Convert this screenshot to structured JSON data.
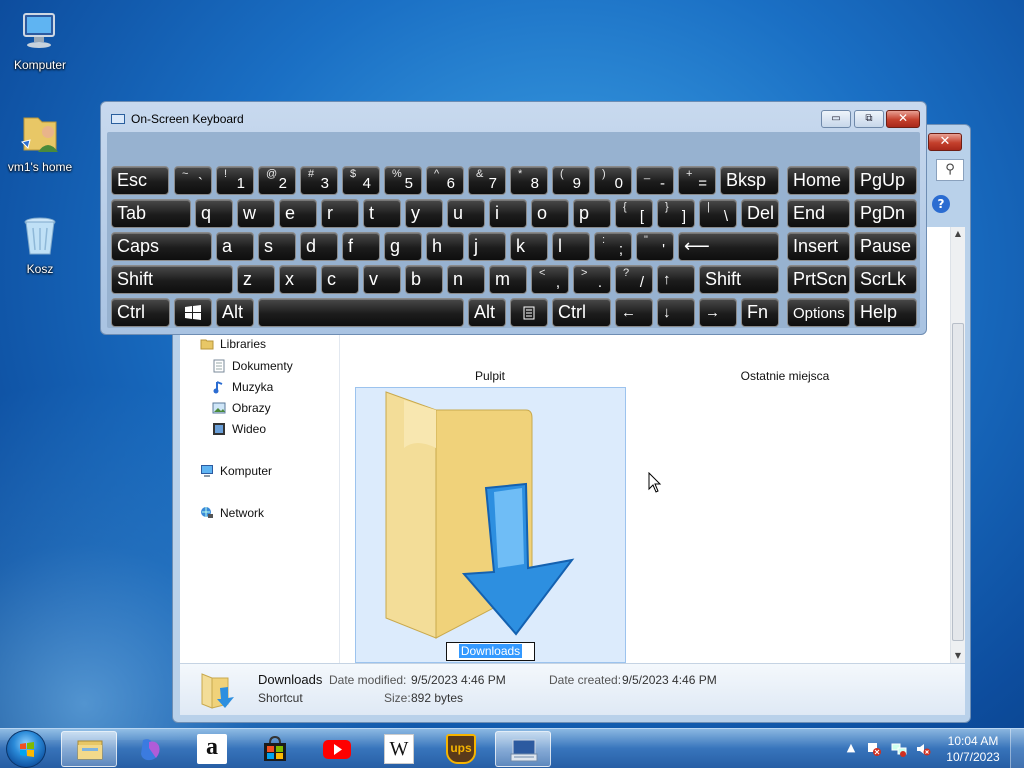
{
  "desktop": {
    "icons": [
      {
        "label": "Komputer"
      },
      {
        "label": "vm1's home"
      },
      {
        "label": "Kosz"
      }
    ]
  },
  "explorer": {
    "close_label": "✕",
    "search_icon": "search-icon",
    "help_label": "?",
    "nav": {
      "libraries": "Libraries",
      "dokumenty": "Dokumenty",
      "muzyka": "Muzyka",
      "obrazy": "Obrazy",
      "wideo": "Wideo",
      "komputer": "Komputer",
      "network": "Network"
    },
    "items": {
      "pulpit": "Pulpit",
      "ostatnie": "Ostatnie miejsca",
      "rename_value": "Downloads"
    },
    "details": {
      "name": "Downloads",
      "type": "Shortcut",
      "modified_label": "Date modified:",
      "modified_value": "9/5/2023 4:46 PM",
      "created_label": "Date created:",
      "created_value": "9/5/2023 4:46 PM",
      "size_label": "Size:",
      "size_value": "892 bytes"
    }
  },
  "osk": {
    "title": "On-Screen Keyboard",
    "window_buttons": {
      "minimize": "▭",
      "restore": "⧉",
      "close": "✕"
    },
    "keys": {
      "esc": "Esc",
      "tab": "Tab",
      "caps": "Caps",
      "shift_l": "Shift",
      "ctrl_l": "Ctrl",
      "alt_l": "Alt",
      "alt_r": "Alt",
      "ctrl_r": "Ctrl",
      "bksp": "Bksp",
      "del": "Del",
      "shift_r": "Shift",
      "home": "Home",
      "pgup": "PgUp",
      "end": "End",
      "pgdn": "PgDn",
      "insert": "Insert",
      "pause": "Pause",
      "prtscn": "PrtScn",
      "scrlk": "ScrLk",
      "options": "Options",
      "help": "Help",
      "fn": "Fn",
      "enter": "⟵",
      "q": "q",
      "w": "w",
      "e": "e",
      "r": "r",
      "t": "t",
      "y": "y",
      "u": "u",
      "i": "i",
      "o": "o",
      "p": "p",
      "a": "a",
      "s": "s",
      "d": "d",
      "f": "f",
      "g": "g",
      "h": "h",
      "j": "j",
      "k": "k",
      "l": "l",
      "z": "z",
      "x": "x",
      "c": "c",
      "v": "v",
      "b": "b",
      "n": "n",
      "m": "m",
      "arrow_up": "↑",
      "arrow_left": "←",
      "arrow_down": "↓",
      "arrow_right": "→"
    },
    "number_row": [
      {
        "shift": "~",
        "base": "`"
      },
      {
        "shift": "!",
        "base": "1"
      },
      {
        "shift": "@",
        "base": "2"
      },
      {
        "shift": "#",
        "base": "3"
      },
      {
        "shift": "$",
        "base": "4"
      },
      {
        "shift": "%",
        "base": "5"
      },
      {
        "shift": "^",
        "base": "6"
      },
      {
        "shift": "&",
        "base": "7"
      },
      {
        "shift": "*",
        "base": "8"
      },
      {
        "shift": "(",
        "base": "9"
      },
      {
        "shift": ")",
        "base": "0"
      },
      {
        "shift": "_",
        "base": "-"
      },
      {
        "shift": "+",
        "base": "="
      }
    ],
    "symbols": {
      "lbracket": {
        "shift": "{",
        "base": "["
      },
      "rbracket": {
        "shift": "}",
        "base": "]"
      },
      "backslash": {
        "shift": "|",
        "base": "\\"
      },
      "semicolon": {
        "shift": ":",
        "base": ";"
      },
      "quote": {
        "shift": "\"",
        "base": "'"
      },
      "comma": {
        "shift": "<",
        "base": ","
      },
      "period": {
        "shift": ">",
        "base": "."
      },
      "slash": {
        "shift": "?",
        "base": "/"
      }
    }
  },
  "taskbar": {
    "time": "10:04 AM",
    "date": "10/7/2023",
    "tray_arrow": "▲",
    "apps": [
      "file-explorer-icon",
      "copilot-icon",
      "amazon-icon",
      "store-bag-icon",
      "youtube-icon",
      "wikipedia-icon",
      "ups-icon",
      "keyboard-icon"
    ],
    "wiki_letter": "W",
    "ups_text": "ups",
    "amazon_letter": "a"
  }
}
